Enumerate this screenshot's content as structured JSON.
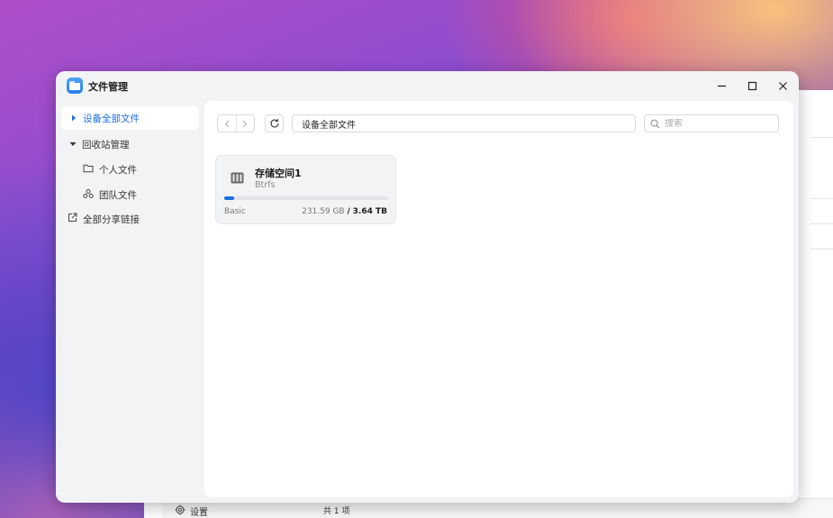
{
  "window": {
    "title": "文件管理",
    "controls": {
      "minimize": "minimize-icon",
      "maximize": "maximize-icon",
      "close": "close-icon"
    }
  },
  "sidebar": {
    "items": [
      {
        "label": "设备全部文件",
        "icon": "caret-right-icon",
        "active": true
      },
      {
        "label": "回收站管理",
        "icon": "caret-down-icon",
        "expanded": true
      },
      {
        "label": "个人文件",
        "icon": "folder-icon"
      },
      {
        "label": "团队文件",
        "icon": "team-icon"
      },
      {
        "label": "全部分享链接",
        "icon": "share-icon"
      }
    ]
  },
  "toolbar": {
    "path": "设备全部文件",
    "search_placeholder": "搜索"
  },
  "storage": {
    "name": "存储空间1",
    "filesystem": "Btrfs",
    "type": "Basic",
    "used": "231.59 GB",
    "separator": "/",
    "total": "3.64 TB",
    "used_fraction": 0.062
  },
  "background_window": {
    "settings_label": "设置",
    "item_count": "共 1 项"
  },
  "colors": {
    "accent": "#1a6fe0",
    "sidebar_bg": "#f2f3f5",
    "content_bg": "#ffffff"
  }
}
